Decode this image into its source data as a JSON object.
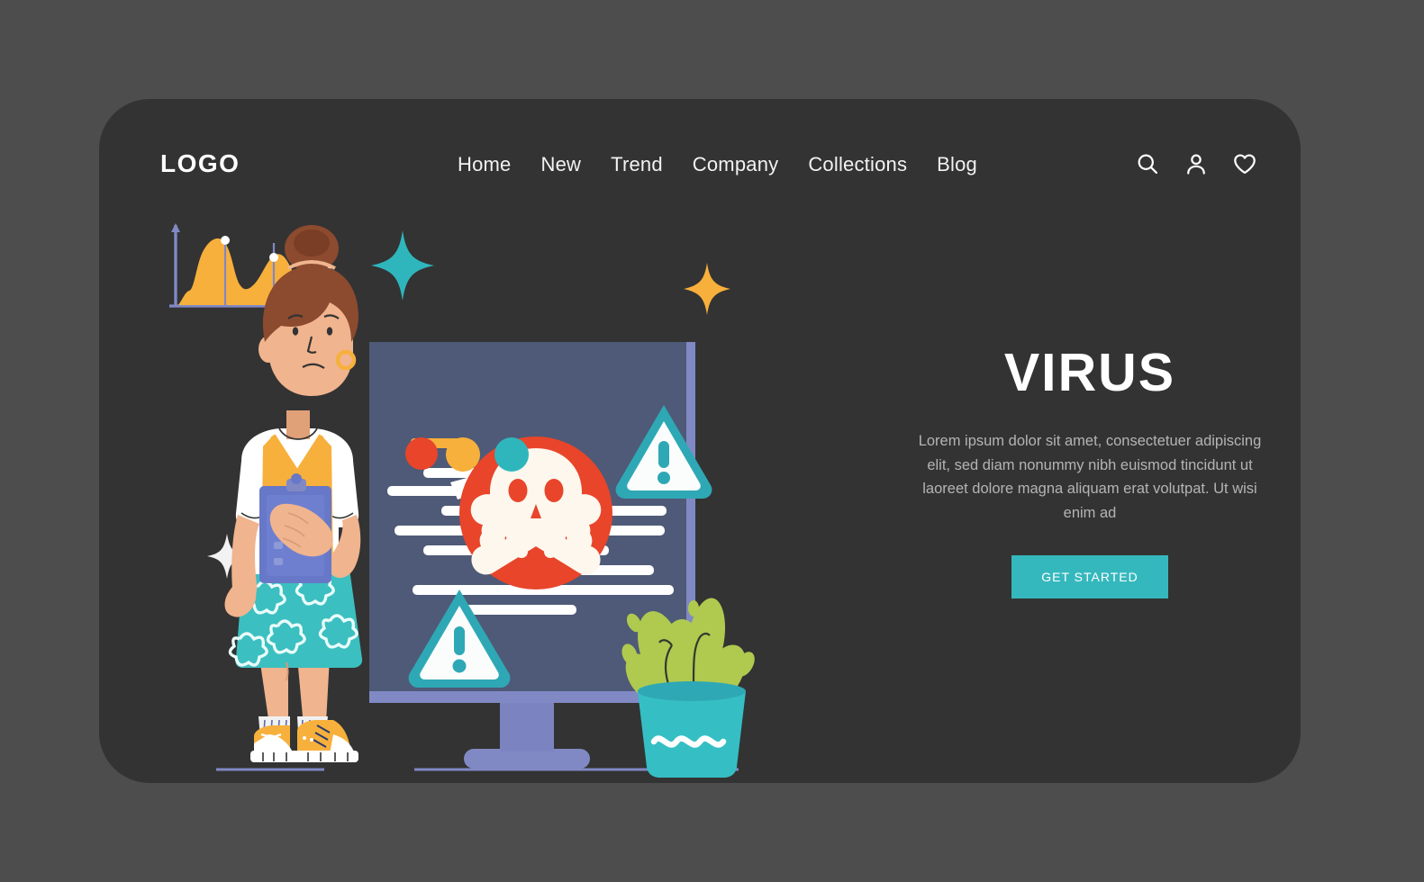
{
  "page": {
    "background_color": "#4d4d4d",
    "card_color": "#333333"
  },
  "header": {
    "logo": "LOGO",
    "nav": [
      {
        "label": "Home"
      },
      {
        "label": "New"
      },
      {
        "label": "Trend"
      },
      {
        "label": "Company"
      },
      {
        "label": "Collections"
      },
      {
        "label": "Blog"
      }
    ],
    "actions": [
      {
        "icon": "search-icon"
      },
      {
        "icon": "user-icon"
      },
      {
        "icon": "heart-icon"
      }
    ]
  },
  "hero": {
    "title": "VIRUS",
    "body": "Lorem ipsum dolor sit amet, consectetuer adipiscing elit, sed diam nonummy nibh euismod tincidunt ut laoreet dolore magna aliquam erat volutpat. Ut wisi enim ad",
    "cta_label": "GET STARTED",
    "cta_color": "#35b8bd",
    "title_color": "#ffffff",
    "body_color": "#b4b4b4"
  },
  "illustration": {
    "name": "virus-alert-illustration",
    "colors": {
      "screen": "#4e5a77",
      "bezel": "#8189c4",
      "alert_red": "#e8452a",
      "teal": "#2fa8b5",
      "amber": "#f7b03c",
      "plant_green": "#a8c martian",
      "skin": "#f0b48e",
      "hair": "#8c4a2f",
      "skirt_teal": "#3cbfc0",
      "white": "#ffffff"
    },
    "elements": [
      {
        "name": "character-woman"
      },
      {
        "name": "monitor"
      },
      {
        "name": "skull-crossbones-icon"
      },
      {
        "name": "warning-triangle-icon"
      },
      {
        "name": "warning-triangle-icon"
      },
      {
        "name": "area-chart"
      },
      {
        "name": "potted-plant"
      },
      {
        "name": "sparkle-teal"
      },
      {
        "name": "sparkle-amber"
      },
      {
        "name": "sparkle-white"
      },
      {
        "name": "dot-red"
      },
      {
        "name": "dot-amber"
      },
      {
        "name": "dot-teal"
      }
    ]
  }
}
